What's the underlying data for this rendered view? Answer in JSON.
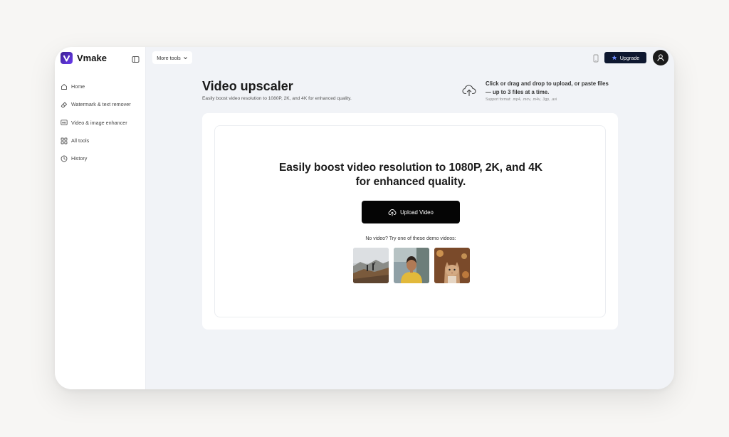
{
  "sidebar": {
    "logo_text": "Vmake",
    "items": [
      {
        "label": "Home",
        "icon": "home-icon"
      },
      {
        "label": "Watermark & text remover",
        "icon": "eraser-icon"
      },
      {
        "label": "Video & image enhancer",
        "icon": "hd-icon"
      },
      {
        "label": "All tools",
        "icon": "grid-icon"
      },
      {
        "label": "History",
        "icon": "clock-icon"
      }
    ]
  },
  "topbar": {
    "more_tools_label": "More tools",
    "upgrade_label": "Upgrade"
  },
  "page": {
    "title": "Video upscaler",
    "subtitle": "Easily boost video resolution to 1080P, 2K, and 4K for enhanced quality."
  },
  "upload_hint": {
    "line1": "Click or drag and drop to upload, or paste files",
    "line2": "— up to 3 files at a time.",
    "formats": "Support format: .mp4, .mov, .m4v, .3gp, .avi"
  },
  "main": {
    "hero_line1": "Easily boost video resolution to 1080P, 2K, and 4K",
    "hero_line2": "for enhanced quality.",
    "upload_button_label": "Upload Video",
    "demo_caption": "No video? Try one of these demo videos:",
    "demos": [
      "demo-hikers",
      "demo-person",
      "demo-cat"
    ]
  },
  "colors": {
    "brand": "#6a3cf0",
    "upgrade_bg": "#0e1830",
    "upload_btn_bg": "#050505",
    "app_bg": "#f1f3f7"
  }
}
